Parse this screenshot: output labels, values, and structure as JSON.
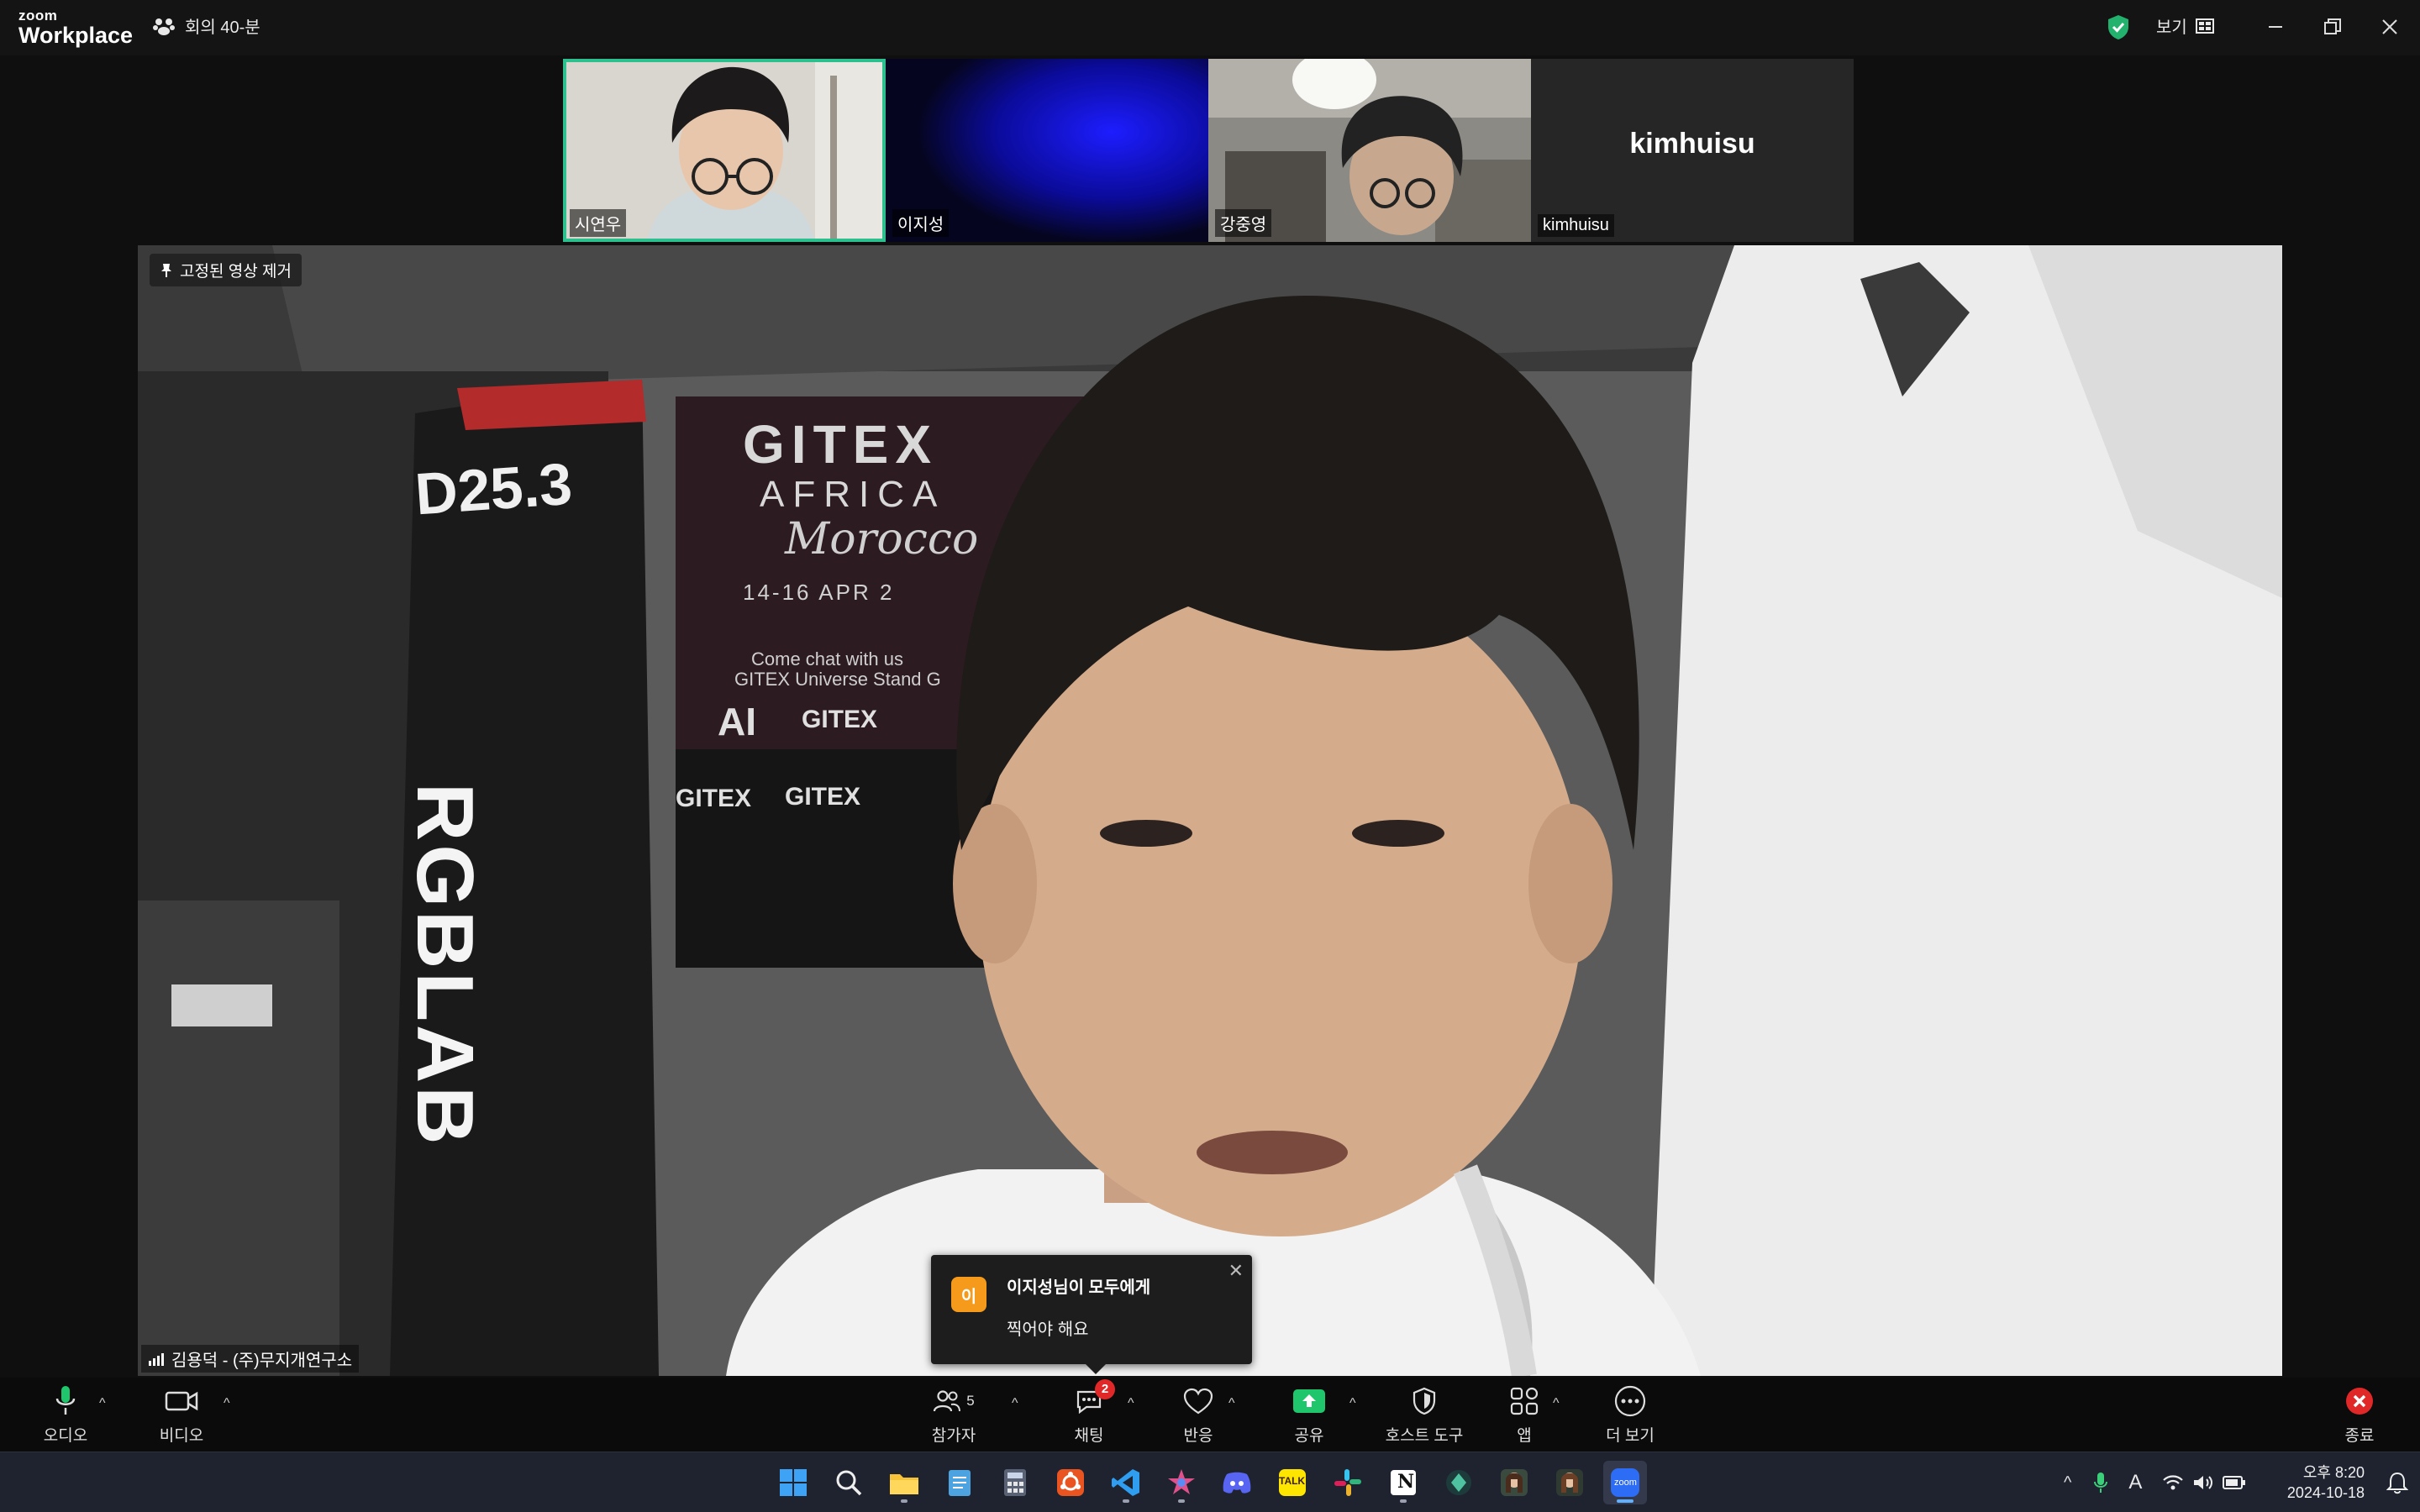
{
  "app": {
    "logo_top": "zoom",
    "logo_bottom": "Workplace",
    "meeting_timer": "회의 40-분",
    "view_label": "보기"
  },
  "thumbnails": [
    {
      "name": "시연우",
      "active": true
    },
    {
      "name": "이지성",
      "active": false
    },
    {
      "name": "강중영",
      "active": false
    },
    {
      "name": "kimhuisu",
      "display_name": "kimhuisu",
      "active": false
    }
  ],
  "main_video": {
    "pin_label": "고정된 영상 제거",
    "speaker_name": "김용덕 - (주)무지개연구소",
    "scene_text": {
      "booth_id": "D25.3",
      "brand": "RGBLAB",
      "banner_title": "GITEX",
      "banner_sub": "AFRICA",
      "banner_script": "Morocco",
      "banner_date": "14-16 APR 2",
      "banner_line": "Come chat with us",
      "banner_line2": "GITEX Universe Stand G",
      "logo_ai": "AI",
      "logo_gitex1": "GITEX",
      "logo_gitex2": "GITEX",
      "logo_gitex3": "GITEX"
    }
  },
  "chat_toast": {
    "avatar_letter": "이",
    "from": "이지성님이 모두에게",
    "message": "찍어야 해요"
  },
  "toolbar": {
    "audio_label": "오디오",
    "video_label": "비디오",
    "participants_label": "참가자",
    "participants_count": "5",
    "chat_label": "채팅",
    "chat_badge": "2",
    "reactions_label": "반응",
    "share_label": "공유",
    "host_tools_label": "호스트 도구",
    "apps_label": "앱",
    "more_label": "더 보기",
    "end_label": "종료"
  },
  "taskbar": {
    "apps": [
      "start-icon",
      "search-icon",
      "file-explorer-icon",
      "notepad-icon",
      "calculator-icon",
      "ubuntu-icon",
      "vscode-icon",
      "photos-icon",
      "discord-icon",
      "kakaotalk-icon",
      "slack-icon",
      "notion-icon",
      "app-icon",
      "avatar-app-icon-1",
      "avatar-app-icon-2",
      "zoom-icon"
    ],
    "kakao_text": "TALK",
    "notion_text": "N",
    "zoom_text": "zoom",
    "ime_label": "A",
    "time": "오후 8:20",
    "date": "2024-10-18"
  },
  "colors": {
    "accent_green": "#2cc08f",
    "share_green": "#1fc66b",
    "end_red": "#e02828",
    "toast_avatar": "#f59a1b",
    "zoom_blue": "#2d6cf5"
  }
}
